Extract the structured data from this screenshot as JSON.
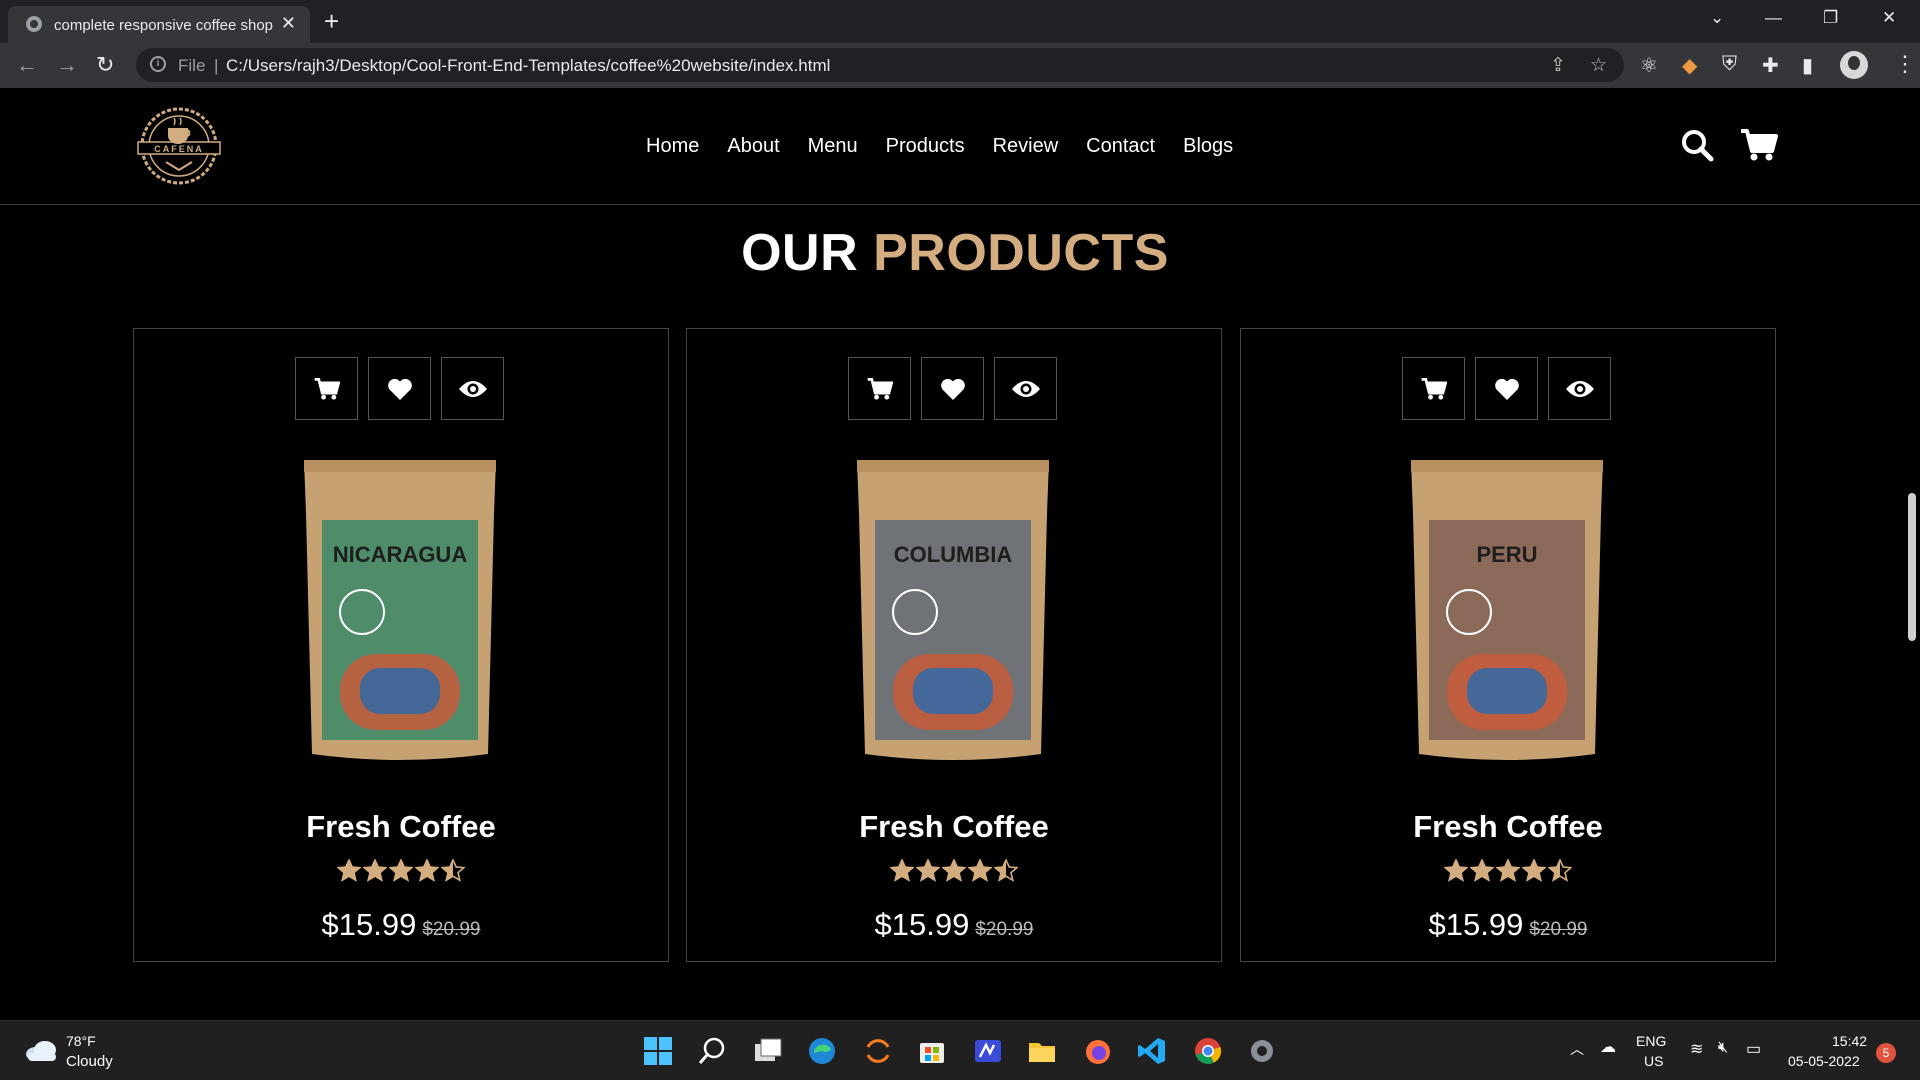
{
  "browser": {
    "tab_title": "complete responsive coffee shop",
    "url_scheme_label": "File",
    "url": "C:/Users/rajh3/Desktop/Cool-Front-End-Templates/coffee%20website/index.html"
  },
  "site": {
    "logo_text": "CAFENA",
    "nav": [
      "Home",
      "About",
      "Menu",
      "Products",
      "Review",
      "Contact",
      "Blogs"
    ],
    "section_title_white": "OUR",
    "section_title_accent": "PRODUCTS",
    "accent_color": "#d3ad7f",
    "products": [
      {
        "name": "Fresh Coffee",
        "rating": 4.5,
        "price": "$15.99",
        "old_price": "$20.99",
        "bag_label": "NICARAGUA",
        "bag_color": "#4e8c6a"
      },
      {
        "name": "Fresh Coffee",
        "rating": 4.5,
        "price": "$15.99",
        "old_price": "$20.99",
        "bag_label": "COLUMBIA",
        "bag_color": "#6f7276"
      },
      {
        "name": "Fresh Coffee",
        "rating": 4.5,
        "price": "$15.99",
        "old_price": "$20.99",
        "bag_label": "PERU",
        "bag_color": "#8b6a5a"
      }
    ]
  },
  "taskbar": {
    "weather_temp": "78°F",
    "weather_desc": "Cloudy",
    "lang_top": "ENG",
    "lang_bottom": "US",
    "time": "15:42",
    "date": "05-05-2022",
    "notifications": "5"
  }
}
